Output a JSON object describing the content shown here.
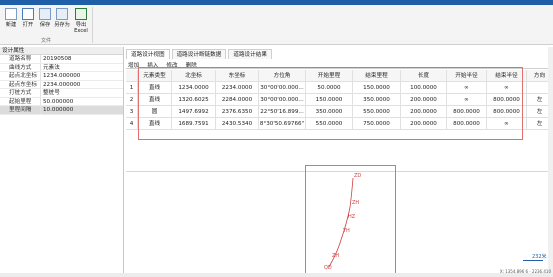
{
  "ribbon": {
    "buttons": [
      {
        "label": "新建",
        "icon": "new-file-icon"
      },
      {
        "label": "打开",
        "icon": "open-file-icon"
      },
      {
        "label": "保存",
        "icon": "save-icon"
      },
      {
        "label": "另存为",
        "icon": "save-as-icon"
      },
      {
        "label": "导出\nExcel",
        "icon": "export-excel-icon"
      }
    ],
    "group_label": "文件"
  },
  "properties": {
    "title": "设计属性",
    "rows": [
      {
        "key": "道路名称",
        "value": "20190508"
      },
      {
        "key": "曲线方式",
        "value": "元素法"
      },
      {
        "key": "起点北坐标",
        "value": "1234.000000"
      },
      {
        "key": "起点东坐标",
        "value": "2234.000000"
      },
      {
        "key": "打桩方式",
        "value": "整桩号"
      },
      {
        "key": "起始里程",
        "value": "50.000000"
      },
      {
        "key": "里程间隔",
        "value": "10.000000"
      }
    ]
  },
  "tabs": [
    "道路设计视图",
    "道路设计断链数据",
    "道路设计结果"
  ],
  "subtools": [
    "增加",
    "插入",
    "修改",
    "删除"
  ],
  "table": {
    "columns": [
      "",
      "元素类型",
      "北坐标",
      "东坐标",
      "方位角",
      "开始里程",
      "结束里程",
      "长度",
      "开始半径",
      "结束半径",
      "方向"
    ],
    "rows": [
      [
        "1",
        "直线",
        "1234.0000",
        "2234.0000",
        "30°00'00.000...",
        "50.0000",
        "150.0000",
        "100.0000",
        "∞",
        "∞",
        ""
      ],
      [
        "2",
        "直线",
        "1320.6025",
        "2284.0000",
        "30°00'00.000...",
        "150.0000",
        "350.0000",
        "200.0000",
        "∞",
        "800.0000",
        "左"
      ],
      [
        "3",
        "圆",
        "1497.6992",
        "2376.6350",
        "22°50'16.899...",
        "350.0000",
        "550.0000",
        "200.0000",
        "800.0000",
        "800.0000",
        "左"
      ],
      [
        "4",
        "直线",
        "1689.7591",
        "2430.5340",
        "8°30'50.69766\"",
        "550.0000",
        "750.0000",
        "200.0000",
        "800.0000",
        "∞",
        "左"
      ]
    ]
  },
  "plot": {
    "labels": [
      "ZD",
      "ZH",
      "HZ",
      "YH",
      "ZH",
      "QD"
    ],
    "scale_label": "232米"
  },
  "status": "X: 1354.896 6 · 2236.410"
}
